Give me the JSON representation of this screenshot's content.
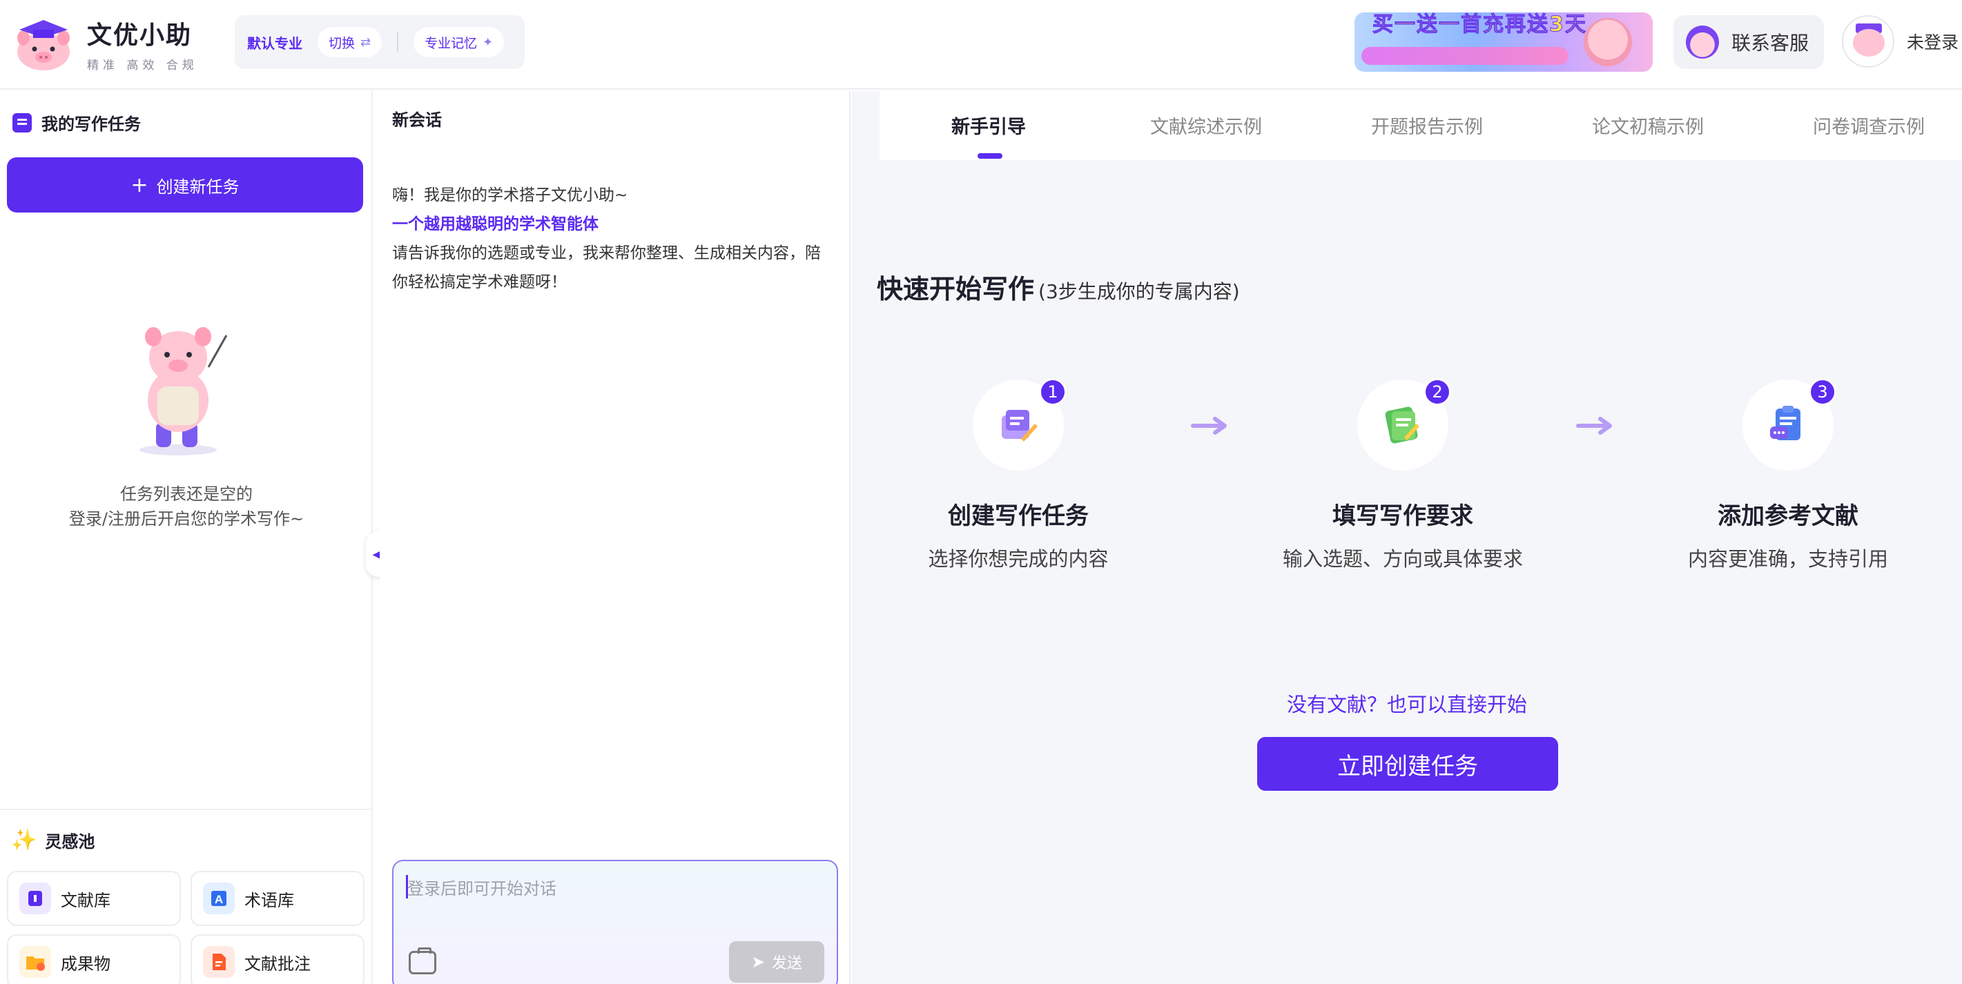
{
  "header": {
    "brand_name": "文优小助",
    "brand_slogan": "精准 高效 合规",
    "major_default": "默认专业",
    "switch_label": "切换",
    "memory_label": "专业记忆",
    "banner_text": "买一送一首充再送3天",
    "service_label": "联系客服",
    "login_label": "未登录"
  },
  "sidebar": {
    "title": "我的写作任务",
    "create_label": "创建新任务",
    "empty_line1": "任务列表还是空的",
    "empty_line2": "登录/注册后开启您的学术写作~",
    "inspiration_title": "灵感池",
    "tools": [
      {
        "label": "文献库",
        "icon": "book-icon"
      },
      {
        "label": "术语库",
        "icon": "term-icon"
      },
      {
        "label": "成果物",
        "icon": "folder-icon"
      },
      {
        "label": "文献批注",
        "icon": "annotate-icon"
      }
    ]
  },
  "chat": {
    "title": "新会话",
    "greeting": "嗨！我是你的学术搭子文优小助~",
    "highlight": "一个越用越聪明的学术智能体",
    "body": "请告诉我你的选题或专业，我来帮你整理、生成相关内容，陪你轻松搞定学术难题呀！",
    "input_placeholder": "登录后即可开始对话",
    "send_label": "发送"
  },
  "right": {
    "tabs": [
      "新手引导",
      "文献综述示例",
      "开题报告示例",
      "论文初稿示例",
      "问卷调查示例"
    ],
    "active_tab": "新手引导",
    "qs_title": "快速开始写作",
    "qs_sub": "(3步生成你的专属内容)",
    "steps": [
      {
        "num": "1",
        "title": "创建写作任务",
        "desc": "选择你想完成的内容"
      },
      {
        "num": "2",
        "title": "填写写作要求",
        "desc": "输入选题、方向或具体要求"
      },
      {
        "num": "3",
        "title": "添加参考文献",
        "desc": "内容更准确，支持引用"
      }
    ],
    "no_literature": "没有文献？也可以直接开始",
    "start_label": "立即创建任务"
  },
  "colors": {
    "accent": "#5b2bf0",
    "panel_bg": "#f5f6f9"
  }
}
